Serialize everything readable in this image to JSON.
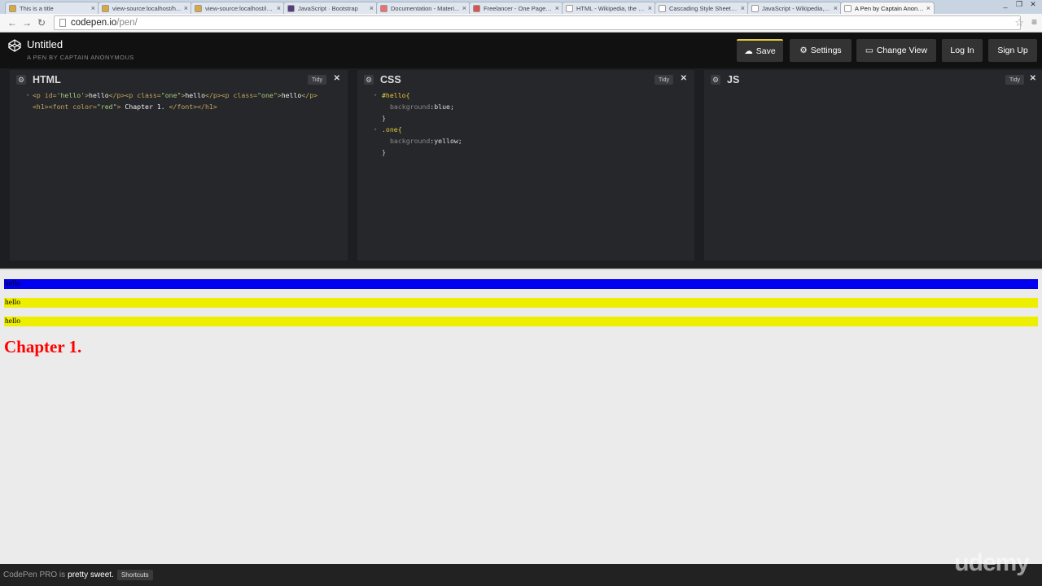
{
  "browser": {
    "tabs": [
      {
        "title": "This is a title",
        "icon": "html-file-icon",
        "color": "#d9a93b"
      },
      {
        "title": "view-source:localhost/h...",
        "icon": "html-file-icon",
        "color": "#d9a93b"
      },
      {
        "title": "view-source:localhost/in...",
        "icon": "html-file-icon",
        "color": "#d9a93b"
      },
      {
        "title": "JavaScript · Bootstrap",
        "icon": "bootstrap-icon",
        "color": "#563d7c"
      },
      {
        "title": "Documentation - Materi...",
        "icon": "materialize-icon",
        "color": "#ee6e73"
      },
      {
        "title": "Freelancer - One Page T...",
        "icon": "freelancer-icon",
        "color": "#d9534f"
      },
      {
        "title": "HTML - Wikipedia, the fr...",
        "icon": "wikipedia-icon",
        "color": "#ffffff"
      },
      {
        "title": "Cascading Style Sheets...",
        "icon": "wikipedia-icon",
        "color": "#ffffff"
      },
      {
        "title": "JavaScript - Wikipedia, t...",
        "icon": "wikipedia-icon",
        "color": "#ffffff"
      },
      {
        "title": "A Pen by Captain Anony...",
        "icon": "codepen-icon",
        "color": "#ffffff"
      }
    ],
    "url_host": "codepen.io",
    "url_path": "/pen/"
  },
  "header": {
    "title": "Untitled",
    "subtitle": "A PEN BY CAPTAIN ANONYMOUS",
    "buttons": {
      "save": "Save",
      "settings": "Settings",
      "change_view": "Change View",
      "login": "Log In",
      "signup": "Sign Up"
    },
    "save_accent": "#e6c93a"
  },
  "editors": {
    "html": {
      "title": "HTML",
      "tidy": "Tidy"
    },
    "css": {
      "title": "CSS",
      "tidy": "Tidy"
    },
    "js": {
      "title": "JS",
      "tidy": "Tidy"
    },
    "html_code": {
      "l1_open": "<p id=",
      "l1_id": "'hello'",
      "l1_gt": ">",
      "l1_txt1": "hello",
      "l1_close1": "</p><p class=",
      "l1_cls1": "\"one\"",
      "l1_gt2": ">",
      "l1_txt2": "hello",
      "l1_close2": "</p><p class=",
      "l1_cls2": "\"one\"",
      "l1_gt3": ">",
      "l1_txt3": "hello",
      "l1_close3": "</p>",
      "l2_open": "<h1><font color=",
      "l2_color": "\"red\"",
      "l2_gt": ">",
      "l2_txt": " Chapter 1. ",
      "l2_close": "</font></h1>"
    },
    "css_code": {
      "sel1": "#hello{",
      "prop1": "background",
      "val1": ":blue;",
      "close1": "}",
      "sel2": ".one{",
      "prop2": "background",
      "val2": ":yellow;",
      "close2": "}"
    }
  },
  "preview": {
    "p1": "hello",
    "p2": "hello",
    "p3": "hello",
    "h1": "Chapter 1.",
    "colors": {
      "blue": "#0000f0",
      "yellow": "#eeee00",
      "red": "#ff0000"
    }
  },
  "footer": {
    "pro": "CodePen PRO is",
    "sweet": "pretty sweet.",
    "shortcuts": "Shortcuts",
    "watermark": "udemy"
  }
}
